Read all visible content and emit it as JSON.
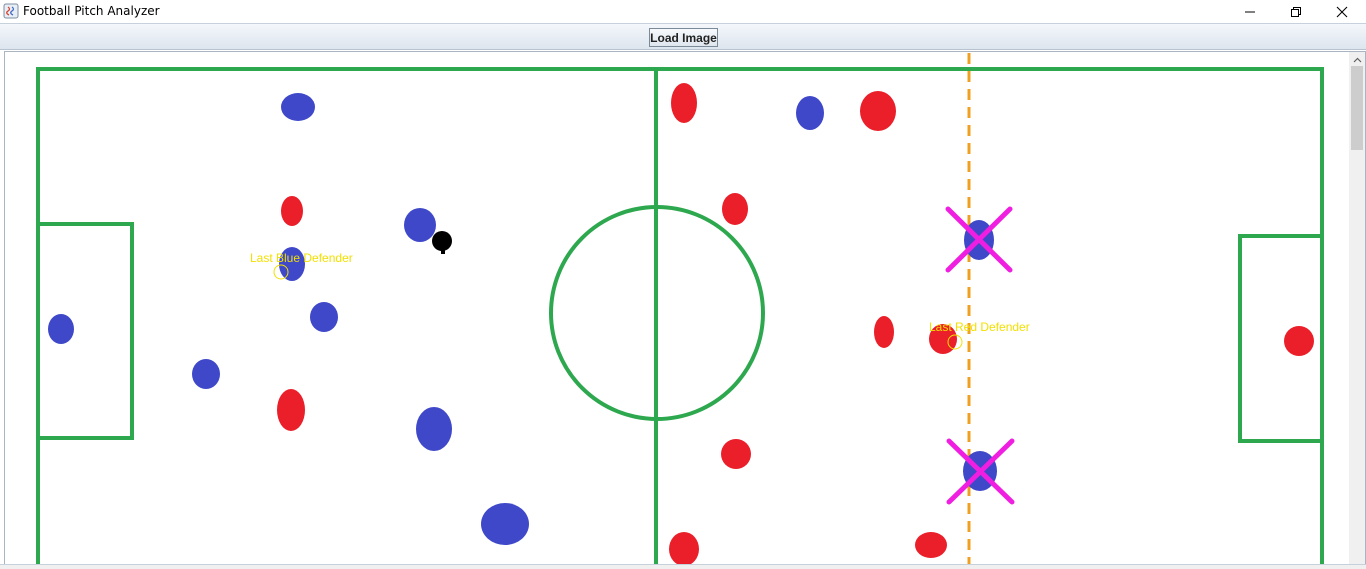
{
  "window": {
    "title": "Football Pitch Analyzer",
    "controls": {
      "minimize": "minimize",
      "maximize": "restore",
      "close": "close"
    }
  },
  "toolbar": {
    "load_label": "Load Image"
  },
  "pitch": {
    "line_color": "#2ea84f",
    "blue_team_color": "#3e48c9",
    "red_team_color": "#ea1f29",
    "ball_color": "#000000",
    "offside_line_color": "#f0a020",
    "marker_color": "#f01ee0",
    "annotation_color": "#f2e000"
  },
  "annotations": {
    "blue_label": "Last Blue Defender",
    "red_label": "Last Red Defender"
  }
}
